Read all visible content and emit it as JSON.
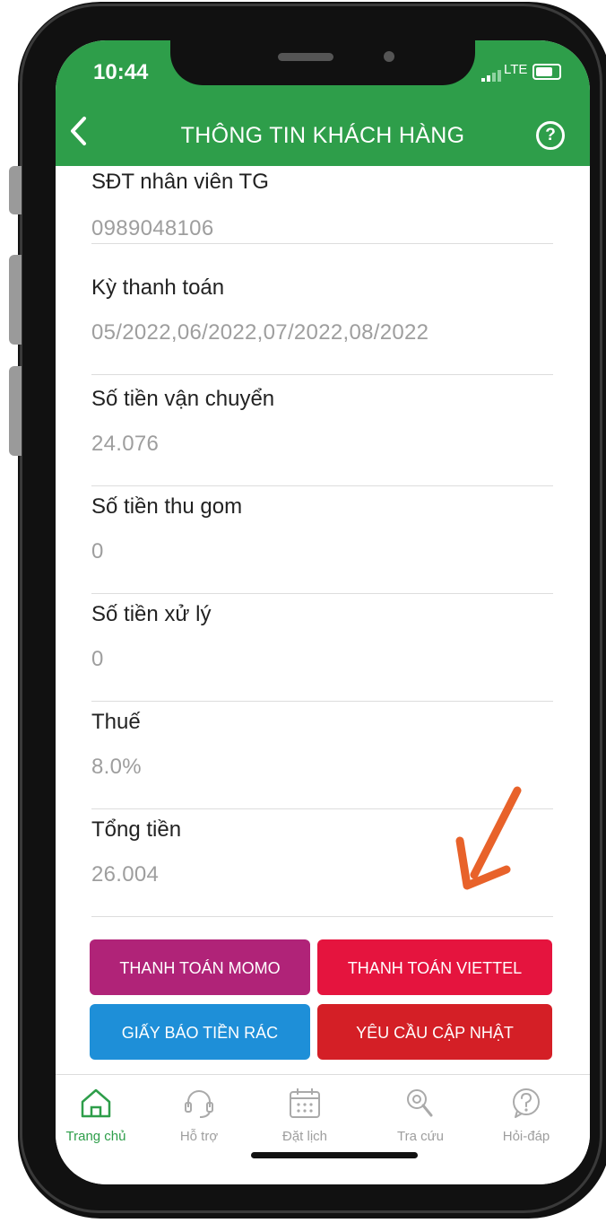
{
  "status": {
    "time": "10:44",
    "network": "LTE"
  },
  "header": {
    "title": "THÔNG TIN KHÁCH HÀNG"
  },
  "fields": [
    {
      "label": "SĐT nhân viên TG",
      "value": "0989048106"
    },
    {
      "label": "Kỳ thanh toán",
      "value": "05/2022,06/2022,07/2022,08/2022"
    },
    {
      "label": "Số tiền vận chuyển",
      "value": "24.076"
    },
    {
      "label": "Số tiền thu gom",
      "value": "0"
    },
    {
      "label": "Số tiền xử lý",
      "value": "0"
    },
    {
      "label": "Thuế",
      "value": "8.0%"
    },
    {
      "label": "Tổng tiền",
      "value": "26.004"
    }
  ],
  "buttons": {
    "momo": "THANH TOÁN MOMO",
    "viettel": "THANH TOÁN VIETTEL",
    "bill": "GIẤY BÁO TIỀN RÁC",
    "update": "YÊU CẦU CẬP NHẬT"
  },
  "tabs": [
    {
      "label": "Trang chủ",
      "icon": "home-icon",
      "active": true
    },
    {
      "label": "Hỗ trợ",
      "icon": "headset-icon",
      "active": false
    },
    {
      "label": "Đặt lịch",
      "icon": "calendar-icon",
      "active": false
    },
    {
      "label": "Tra cứu",
      "icon": "search-icon",
      "active": false
    },
    {
      "label": "Hỏi-đáp",
      "icon": "question-icon",
      "active": false
    }
  ],
  "colors": {
    "brand": "#2e9e4a",
    "momo": "#b02378",
    "viettel": "#e5143e",
    "bill": "#1e8fd8",
    "update": "#d41f26",
    "annotation_arrow": "#e8622a"
  }
}
